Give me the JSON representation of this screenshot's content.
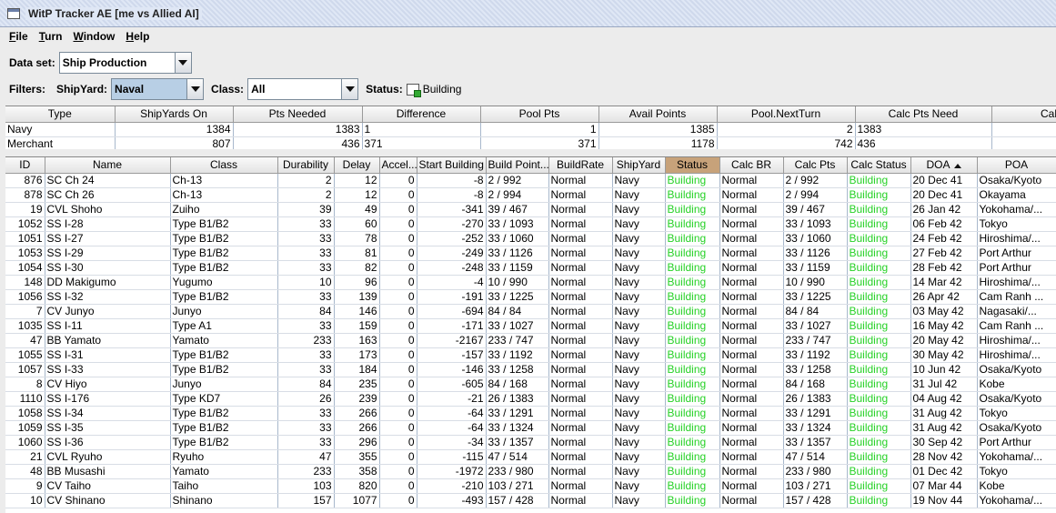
{
  "window": {
    "title": "WitP Tracker AE [me vs Allied AI]"
  },
  "menu": [
    "File",
    "Turn",
    "Window",
    "Help"
  ],
  "dataset": {
    "label": "Data set:",
    "value": "Ship Production"
  },
  "filters": {
    "label": "Filters:",
    "shipyard_label": "ShipYard:",
    "shipyard_value": "Naval",
    "class_label": "Class:",
    "class_value": "All",
    "status_label": "Status:",
    "status_value": "Building"
  },
  "summary": {
    "columns": [
      "Type",
      "ShipYards On",
      "Pts Needed",
      "Difference",
      "Pool Pts",
      "Avail Points",
      "Pool.NextTurn",
      "Calc Pts Need",
      "Cal"
    ],
    "rows": [
      [
        "Navy",
        "1384",
        "1383",
        "1",
        "1",
        "1385",
        "2",
        "1383",
        ""
      ],
      [
        "Merchant",
        "807",
        "436",
        "371",
        "371",
        "1178",
        "742",
        "436",
        ""
      ]
    ]
  },
  "table": {
    "columns": [
      "ID",
      "Name",
      "Class",
      "Durability",
      "Delay",
      "Accel...",
      "Start Building",
      "Build Point...",
      "BuildRate",
      "ShipYard",
      "Status",
      "Calc BR",
      "Calc Pts",
      "Calc Status",
      "DOA",
      "POA"
    ],
    "sorted_column": "DOA",
    "status_color": "#27d127",
    "rows": [
      [
        "876",
        "SC Ch 24",
        "Ch-13",
        "2",
        "12",
        "0",
        "-8",
        "2 / 992",
        "Normal",
        "Navy",
        "Building",
        "Normal",
        "2 / 992",
        "Building",
        "20 Dec 41",
        "Osaka/Kyoto"
      ],
      [
        "878",
        "SC Ch 26",
        "Ch-13",
        "2",
        "12",
        "0",
        "-8",
        "2 / 994",
        "Normal",
        "Navy",
        "Building",
        "Normal",
        "2 / 994",
        "Building",
        "20 Dec 41",
        "Okayama"
      ],
      [
        "19",
        "CVL Shoho",
        "Zuiho",
        "39",
        "49",
        "0",
        "-341",
        "39 / 467",
        "Normal",
        "Navy",
        "Building",
        "Normal",
        "39 / 467",
        "Building",
        "26 Jan 42",
        "Yokohama/..."
      ],
      [
        "1052",
        "SS I-28",
        "Type B1/B2",
        "33",
        "60",
        "0",
        "-270",
        "33 / 1093",
        "Normal",
        "Navy",
        "Building",
        "Normal",
        "33 / 1093",
        "Building",
        "06 Feb 42",
        "Tokyo"
      ],
      [
        "1051",
        "SS I-27",
        "Type B1/B2",
        "33",
        "78",
        "0",
        "-252",
        "33 / 1060",
        "Normal",
        "Navy",
        "Building",
        "Normal",
        "33 / 1060",
        "Building",
        "24 Feb 42",
        "Hiroshima/..."
      ],
      [
        "1053",
        "SS I-29",
        "Type B1/B2",
        "33",
        "81",
        "0",
        "-249",
        "33 / 1126",
        "Normal",
        "Navy",
        "Building",
        "Normal",
        "33 / 1126",
        "Building",
        "27 Feb 42",
        "Port Arthur"
      ],
      [
        "1054",
        "SS I-30",
        "Type B1/B2",
        "33",
        "82",
        "0",
        "-248",
        "33 / 1159",
        "Normal",
        "Navy",
        "Building",
        "Normal",
        "33 / 1159",
        "Building",
        "28 Feb 42",
        "Port Arthur"
      ],
      [
        "148",
        "DD Makigumo",
        "Yugumo",
        "10",
        "96",
        "0",
        "-4",
        "10 / 990",
        "Normal",
        "Navy",
        "Building",
        "Normal",
        "10 / 990",
        "Building",
        "14 Mar 42",
        "Hiroshima/..."
      ],
      [
        "1056",
        "SS I-32",
        "Type B1/B2",
        "33",
        "139",
        "0",
        "-191",
        "33 / 1225",
        "Normal",
        "Navy",
        "Building",
        "Normal",
        "33 / 1225",
        "Building",
        "26 Apr 42",
        "Cam Ranh ..."
      ],
      [
        "7",
        "CV Junyo",
        "Junyo",
        "84",
        "146",
        "0",
        "-694",
        "84 / 84",
        "Normal",
        "Navy",
        "Building",
        "Normal",
        "84 / 84",
        "Building",
        "03 May 42",
        "Nagasaki/..."
      ],
      [
        "1035",
        "SS I-11",
        "Type A1",
        "33",
        "159",
        "0",
        "-171",
        "33 / 1027",
        "Normal",
        "Navy",
        "Building",
        "Normal",
        "33 / 1027",
        "Building",
        "16 May 42",
        "Cam Ranh ..."
      ],
      [
        "47",
        "BB Yamato",
        "Yamato",
        "233",
        "163",
        "0",
        "-2167",
        "233 / 747",
        "Normal",
        "Navy",
        "Building",
        "Normal",
        "233 / 747",
        "Building",
        "20 May 42",
        "Hiroshima/..."
      ],
      [
        "1055",
        "SS I-31",
        "Type B1/B2",
        "33",
        "173",
        "0",
        "-157",
        "33 / 1192",
        "Normal",
        "Navy",
        "Building",
        "Normal",
        "33 / 1192",
        "Building",
        "30 May 42",
        "Hiroshima/..."
      ],
      [
        "1057",
        "SS I-33",
        "Type B1/B2",
        "33",
        "184",
        "0",
        "-146",
        "33 / 1258",
        "Normal",
        "Navy",
        "Building",
        "Normal",
        "33 / 1258",
        "Building",
        "10 Jun 42",
        "Osaka/Kyoto"
      ],
      [
        "8",
        "CV Hiyo",
        "Junyo",
        "84",
        "235",
        "0",
        "-605",
        "84 / 168",
        "Normal",
        "Navy",
        "Building",
        "Normal",
        "84 / 168",
        "Building",
        "31 Jul 42",
        "Kobe"
      ],
      [
        "1110",
        "SS I-176",
        "Type KD7",
        "26",
        "239",
        "0",
        "-21",
        "26 / 1383",
        "Normal",
        "Navy",
        "Building",
        "Normal",
        "26 / 1383",
        "Building",
        "04 Aug 42",
        "Osaka/Kyoto"
      ],
      [
        "1058",
        "SS I-34",
        "Type B1/B2",
        "33",
        "266",
        "0",
        "-64",
        "33 / 1291",
        "Normal",
        "Navy",
        "Building",
        "Normal",
        "33 / 1291",
        "Building",
        "31 Aug 42",
        "Tokyo"
      ],
      [
        "1059",
        "SS I-35",
        "Type B1/B2",
        "33",
        "266",
        "0",
        "-64",
        "33 / 1324",
        "Normal",
        "Navy",
        "Building",
        "Normal",
        "33 / 1324",
        "Building",
        "31 Aug 42",
        "Osaka/Kyoto"
      ],
      [
        "1060",
        "SS I-36",
        "Type B1/B2",
        "33",
        "296",
        "0",
        "-34",
        "33 / 1357",
        "Normal",
        "Navy",
        "Building",
        "Normal",
        "33 / 1357",
        "Building",
        "30 Sep 42",
        "Port Arthur"
      ],
      [
        "21",
        "CVL Ryuho",
        "Ryuho",
        "47",
        "355",
        "0",
        "-115",
        "47 / 514",
        "Normal",
        "Navy",
        "Building",
        "Normal",
        "47 / 514",
        "Building",
        "28 Nov 42",
        "Yokohama/..."
      ],
      [
        "48",
        "BB Musashi",
        "Yamato",
        "233",
        "358",
        "0",
        "-1972",
        "233 / 980",
        "Normal",
        "Navy",
        "Building",
        "Normal",
        "233 / 980",
        "Building",
        "01 Dec 42",
        "Tokyo"
      ],
      [
        "9",
        "CV Taiho",
        "Taiho",
        "103",
        "820",
        "0",
        "-210",
        "103 / 271",
        "Normal",
        "Navy",
        "Building",
        "Normal",
        "103 / 271",
        "Building",
        "07 Mar 44",
        "Kobe"
      ],
      [
        "10",
        "CV Shinano",
        "Shinano",
        "157",
        "1077",
        "0",
        "-493",
        "157 / 428",
        "Normal",
        "Navy",
        "Building",
        "Normal",
        "157 / 428",
        "Building",
        "19 Nov 44",
        "Yokohama/..."
      ]
    ]
  }
}
